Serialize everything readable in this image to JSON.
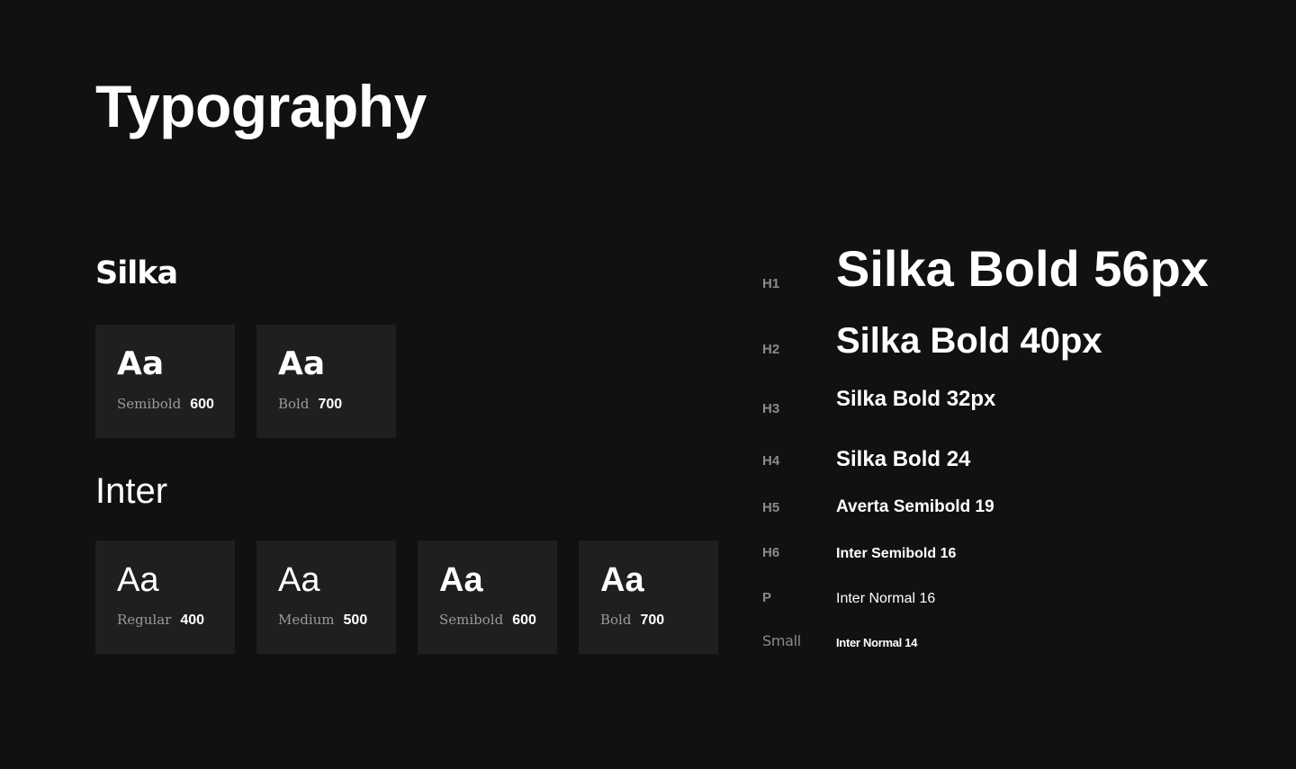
{
  "page": {
    "title": "Typography"
  },
  "families": {
    "silka": {
      "name": "Silka",
      "weights": [
        {
          "sample": "Aa",
          "label": "Semibold",
          "value": "600"
        },
        {
          "sample": "Aa",
          "label": "Bold",
          "value": "700"
        }
      ]
    },
    "inter": {
      "name": "Inter",
      "weights": [
        {
          "sample": "Aa",
          "label": "Regular",
          "value": "400"
        },
        {
          "sample": "Aa",
          "label": "Medium",
          "value": "500"
        },
        {
          "sample": "Aa",
          "label": "Semibold",
          "value": "600"
        },
        {
          "sample": "Aa",
          "label": "Bold",
          "value": "700"
        }
      ]
    }
  },
  "scale": [
    {
      "tag": "H1",
      "sample": "Silka Bold 56px"
    },
    {
      "tag": "H2",
      "sample": "Silka Bold 40px"
    },
    {
      "tag": "H3",
      "sample": "Silka Bold 32px"
    },
    {
      "tag": "H4",
      "sample": "Silka Bold 24"
    },
    {
      "tag": "H5",
      "sample": "Averta Semibold 19"
    },
    {
      "tag": "H6",
      "sample": "Inter Semibold 16"
    },
    {
      "tag": "P",
      "sample": "Inter Normal 16"
    },
    {
      "tag": "Small",
      "sample": "Inter Normal 14"
    }
  ],
  "colors": {
    "background": "#111111",
    "card": "#1f1f1f",
    "text": "#ffffff",
    "muted": "#8a8a8a"
  }
}
